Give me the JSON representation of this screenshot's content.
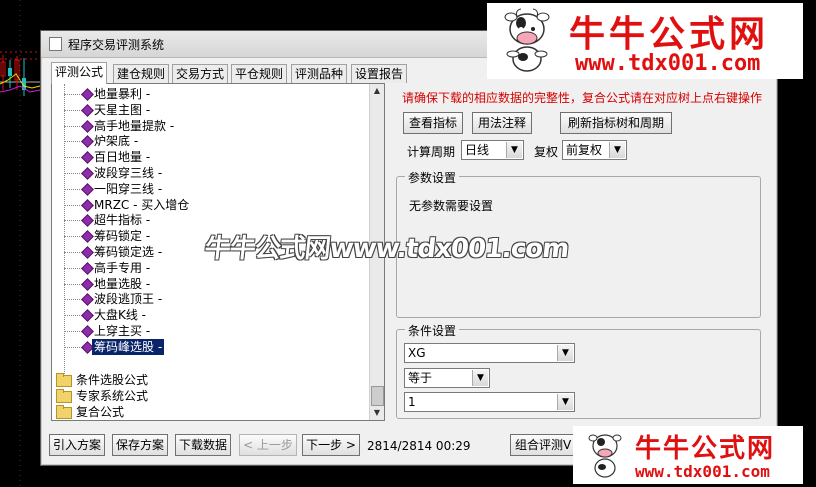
{
  "window": {
    "title": "程序交易评测系统"
  },
  "tabs": [
    "评测公式",
    "建仓规则",
    "交易方式",
    "平仓规则",
    "评测品种",
    "设置报告"
  ],
  "tree": {
    "formulas": [
      "地量暴利 -",
      "天星主图 -",
      "高手地量提款 -",
      "炉架底 -",
      "百日地量 -",
      "波段穿三线 -",
      "一阳穿三线 -",
      "MRZC - 买入增仓",
      "超牛指标 -",
      "筹码锁定 -",
      "筹码锁定选 -",
      "高手专用 -",
      "地量选股 -",
      "波段逃顶王 -",
      "大盘K线 -",
      "上穿主买 -",
      "筹码峰选股 -"
    ],
    "selected_index": 16,
    "folders": [
      "条件选股公式",
      "专家系统公式",
      "复合公式"
    ]
  },
  "right": {
    "notice": "请确保下载的相应数据的完整性，复合公式请在对应树上点右键操作",
    "buttons": {
      "view_indicator": "查看指标",
      "usage_notes": "用法注释",
      "refresh_tree": "刷新指标树和周期"
    },
    "period_label": "计算周期",
    "period_value": "日线",
    "adjust_label": "复权",
    "adjust_value": "前复权",
    "param_group_title": "参数设置",
    "param_text": "无参数需要设置",
    "condition_group_title": "条件设置",
    "condition_var": "XG",
    "condition_op": "等于",
    "condition_value": "1"
  },
  "bottom": {
    "import_btn": "引入方案",
    "save_btn": "保存方案",
    "download_btn": "下载数据",
    "prev_btn": "< 上一步",
    "next_btn": "下一步 >",
    "status": "2814/2814 00:29",
    "combo_btn": "组合评测V"
  },
  "watermark": "牛牛公式网www.tdx001.com",
  "logo": {
    "brand": "牛牛公式网",
    "url": "www.tdx001.com"
  },
  "colors": {
    "notice_red": "#d40000",
    "selected_bg": "#0a246a",
    "formula_icon": "#8e2ea8",
    "logo_red": "#e01010"
  }
}
